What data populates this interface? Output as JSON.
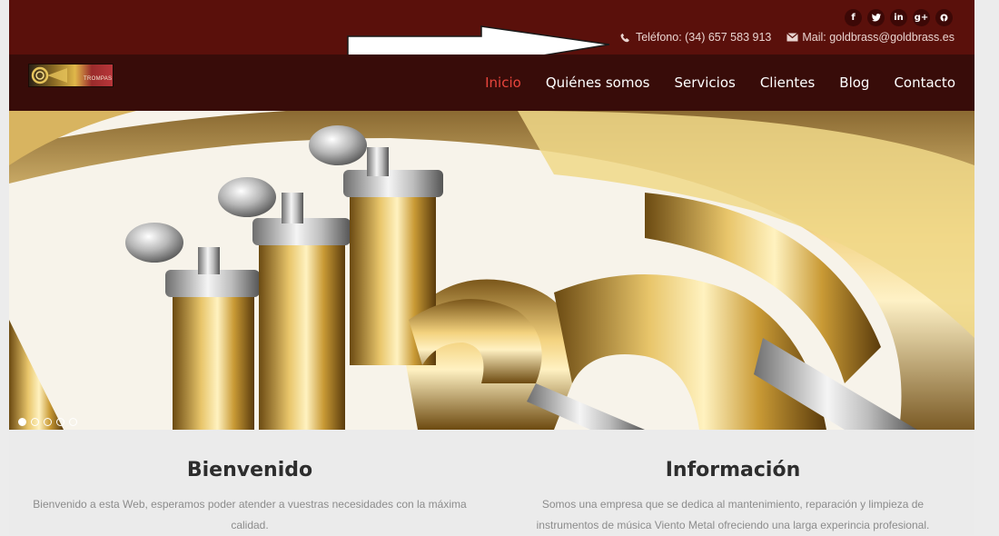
{
  "brand": {
    "logo_text": "TROMPAS",
    "brand_color": "#5a100b",
    "nav_bg": "#380c09",
    "active_color": "#e8453c"
  },
  "social": [
    {
      "name": "facebook-icon",
      "glyph": "f"
    },
    {
      "name": "twitter-icon",
      "glyph": "t"
    },
    {
      "name": "linkedin-icon",
      "glyph": "in"
    },
    {
      "name": "google-plus-icon",
      "glyph": "g+"
    },
    {
      "name": "pinterest-icon",
      "glyph": "p"
    }
  ],
  "contact": {
    "phone": "Teléfono: (34) 657 583 913",
    "mail": "Mail: goldbrass@goldbrass.es"
  },
  "nav": [
    {
      "label": "Inicio",
      "active": true
    },
    {
      "label": "Quiénes somos",
      "active": false
    },
    {
      "label": "Servicios",
      "active": false
    },
    {
      "label": "Clientes",
      "active": false
    },
    {
      "label": "Blog",
      "active": false
    },
    {
      "label": "Contacto",
      "active": false
    }
  ],
  "slider": {
    "total_slides": 5,
    "current_slide": 1
  },
  "sections": {
    "welcome_title": "Bienvenido",
    "welcome_text": "Bienvenido a esta Web, esperamos poder atender a vuestras necesidades con la máxima calidad.",
    "info_title": "Información",
    "info_text": "Somos una empresa que se dedica al mantenimiento, reparación y limpieza de instrumentos de música Viento Metal ofreciendo una larga experincia profesional."
  }
}
